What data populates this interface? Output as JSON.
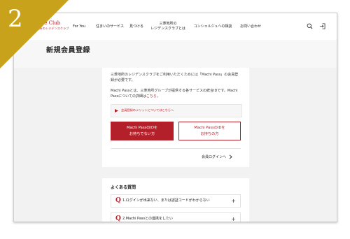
{
  "badge": {
    "number": "2"
  },
  "header": {
    "logo_text": "idence Club",
    "logo_sub": "三菱地所のレジデンスクラブ",
    "nav": [
      "For You",
      "住まいのサービス",
      "見つける",
      "三菱地所の\nレジデンスクラブとは",
      "コンシェルジュへの相談",
      "お問い合わせ"
    ]
  },
  "page": {
    "title": "新規会員登録"
  },
  "register": {
    "intro": "三菱地所のレジデンスクラブをご利用いただくためには「Machi Pass」の会員登録が必要です。",
    "about": "Machi Passとは、三菱地所グループが提供する各サービスの統合IDです。Machi Passについての詳細は",
    "about_link": "こちら",
    "about_end": "。",
    "merit_link": "会員登録のメリットについてはこちらへ",
    "btn_no_id": "Machi PassのIDを\nお持ちでない方",
    "btn_has_id": "Machi PassのIDを\nお持ちの方",
    "login_link": "会員ログインへ"
  },
  "faq": {
    "title": "よくある質問",
    "items": [
      {
        "q": "Q",
        "text": "1.ログインが出来ない、または認証コードがわからない"
      },
      {
        "q": "Q",
        "text": "2.Machi Passとの連携をしたい"
      }
    ]
  },
  "colors": {
    "accent": "#b3202a",
    "badge": "#c9a21c"
  }
}
